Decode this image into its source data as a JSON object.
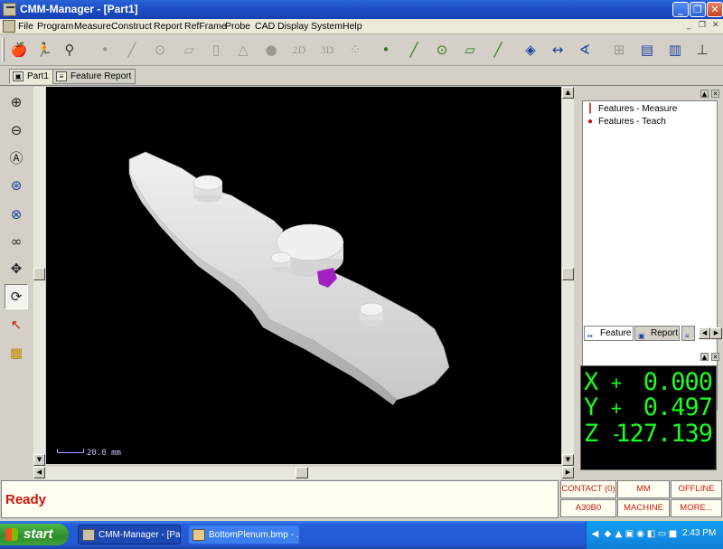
{
  "window": {
    "title": "CMM-Manager - [Part1]",
    "controls": {
      "minimize": "_",
      "restore": "❐",
      "close": "✕"
    }
  },
  "menubar": {
    "items": [
      "File",
      "Program",
      "Measure",
      "Construct",
      "Report",
      "RefFrame",
      "Probe",
      "CAD",
      "Display",
      "System",
      "Help"
    ],
    "mdi_controls": {
      "minimize": "_",
      "restore": "❐",
      "close": "✕"
    }
  },
  "toolbar": {
    "buttons": [
      {
        "name": "teach-icon",
        "glyph": "🍎"
      },
      {
        "name": "run-icon",
        "glyph": "🏃"
      },
      {
        "name": "probe-icon",
        "glyph": "⚲"
      },
      {
        "name": "point-icon",
        "glyph": "•"
      },
      {
        "name": "line-icon",
        "glyph": "╱"
      },
      {
        "name": "circle-icon",
        "glyph": "⊙"
      },
      {
        "name": "plane-icon",
        "glyph": "▱"
      },
      {
        "name": "cylinder-icon",
        "glyph": "▯"
      },
      {
        "name": "cone-icon",
        "glyph": "△"
      },
      {
        "name": "sphere-icon",
        "glyph": "●"
      },
      {
        "name": "2d-icon",
        "glyph": "2D"
      },
      {
        "name": "3d-icon",
        "glyph": "3D"
      },
      {
        "name": "cloud-icon",
        "glyph": "⁘"
      },
      {
        "name": "construct-point-icon",
        "glyph": "•"
      },
      {
        "name": "construct-line-icon",
        "glyph": "╱"
      },
      {
        "name": "construct-circle-icon",
        "glyph": "⊙"
      },
      {
        "name": "construct-plane-icon",
        "glyph": "▱"
      },
      {
        "name": "construct-edge-icon",
        "glyph": "╱"
      },
      {
        "name": "tolerance-icon",
        "glyph": "◈"
      },
      {
        "name": "distance-icon",
        "glyph": "↔"
      },
      {
        "name": "angle-icon",
        "glyph": "∢"
      },
      {
        "name": "align-icon",
        "glyph": "⊞"
      },
      {
        "name": "report-view-icon",
        "glyph": "▤"
      },
      {
        "name": "chart-icon",
        "glyph": "▥"
      },
      {
        "name": "joystick-icon",
        "glyph": "⊥"
      }
    ]
  },
  "doctabs": [
    {
      "label": "Part1",
      "active": true
    },
    {
      "label": "Feature Report",
      "active": false
    }
  ],
  "lefttools": [
    {
      "name": "zoom-in-icon",
      "glyph": "⊕"
    },
    {
      "name": "zoom-out-icon",
      "glyph": "⊖"
    },
    {
      "name": "zoom-all-icon",
      "glyph": "Ⓐ"
    },
    {
      "name": "zoom-window-icon",
      "glyph": "⊛"
    },
    {
      "name": "zoom-fit-icon",
      "glyph": "⊗"
    },
    {
      "name": "view-glasses-icon",
      "glyph": "∞"
    },
    {
      "name": "pan-icon",
      "glyph": "✥"
    },
    {
      "name": "rotate-icon",
      "glyph": "⟳"
    },
    {
      "name": "select-icon",
      "glyph": "↖"
    },
    {
      "name": "highlight-icon",
      "glyph": "▦"
    }
  ],
  "viewport": {
    "scale_label": "20.0 mm",
    "background": "#000000",
    "part_color": "#e8e8e8",
    "highlight_color": "#a020c0"
  },
  "feature_tree": {
    "items": [
      "Features - Measure",
      "Features - Teach"
    ]
  },
  "panel_tabs": [
    "Feature",
    "Report"
  ],
  "dro": {
    "color": "#18ff20",
    "rows": [
      {
        "axis": "X",
        "sign": "+",
        "value": "0.000"
      },
      {
        "axis": "Y",
        "sign": "+",
        "value": "0.497"
      },
      {
        "axis": "Z",
        "sign": "-",
        "value": "127.139"
      }
    ]
  },
  "status": {
    "ready": "Ready",
    "cells": [
      "CONTACT (0)",
      "MM",
      "OFFLINE",
      "A30B0",
      "MACHINE",
      "MORE..."
    ]
  },
  "taskbar": {
    "start": "start",
    "tasks": [
      {
        "label": "CMM-Manager - [Part1]",
        "active": true
      },
      {
        "label": "BottomPlenum.bmp - ...",
        "active": false
      }
    ],
    "clock": "2:43 PM"
  }
}
